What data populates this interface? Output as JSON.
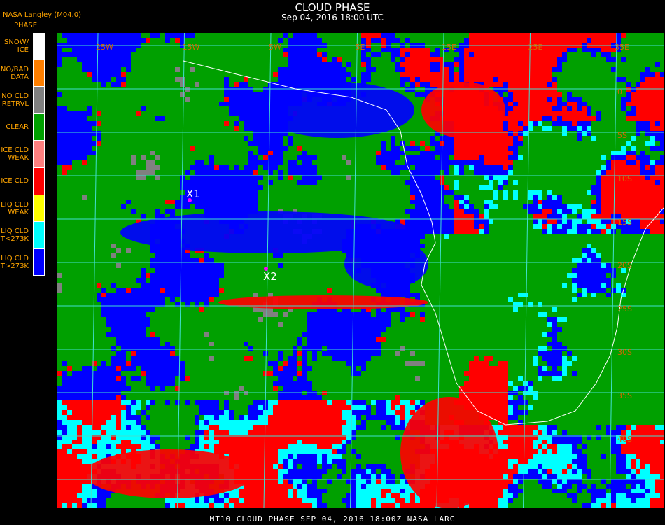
{
  "title": "CLOUD PHASE",
  "subtitle": "Sep 04, 2016 18:00 UTC",
  "brand": "NASA Langley (M04.0)",
  "legend_title": "PHASE",
  "legend": [
    {
      "line1": "SNOW/",
      "line2": "ICE",
      "color": "#ffffff"
    },
    {
      "line1": "NO/BAD",
      "line2": "DATA",
      "color": "#ff7f00"
    },
    {
      "line1": "NO CLD",
      "line2": "RETRVL",
      "color": "#808080"
    },
    {
      "line1": "CLEAR",
      "line2": "",
      "color": "#00a000"
    },
    {
      "line1": "ICE CLD",
      "line2": "WEAK",
      "color": "#ff8080"
    },
    {
      "line1": "ICE CLD",
      "line2": "",
      "color": "#ff0000"
    },
    {
      "line1": "LIQ CLD",
      "line2": "WEAK",
      "color": "#ffff00"
    },
    {
      "line1": "LIQ CLD",
      "line2": "T<273K",
      "color": "#00ffff"
    },
    {
      "line1": "LIQ CLD",
      "line2": "T>273K",
      "color": "#0000ff"
    }
  ],
  "markers": [
    {
      "label": "X1"
    },
    {
      "label": "X2"
    }
  ],
  "lon_labels": [
    "25W",
    "15W",
    "5W",
    "5E",
    "15E",
    "25E",
    "35E"
  ],
  "lat_labels": [
    "0",
    "5S",
    "10S",
    "15S",
    "20S",
    "25S",
    "30S",
    "35S",
    "40S"
  ],
  "bottom_caption": "MT10   CLOUD PHASE   SEP 04, 2016 18:00Z   NASA LARC",
  "grid_color": "#40e0d0",
  "coast_color": "#ffffff"
}
